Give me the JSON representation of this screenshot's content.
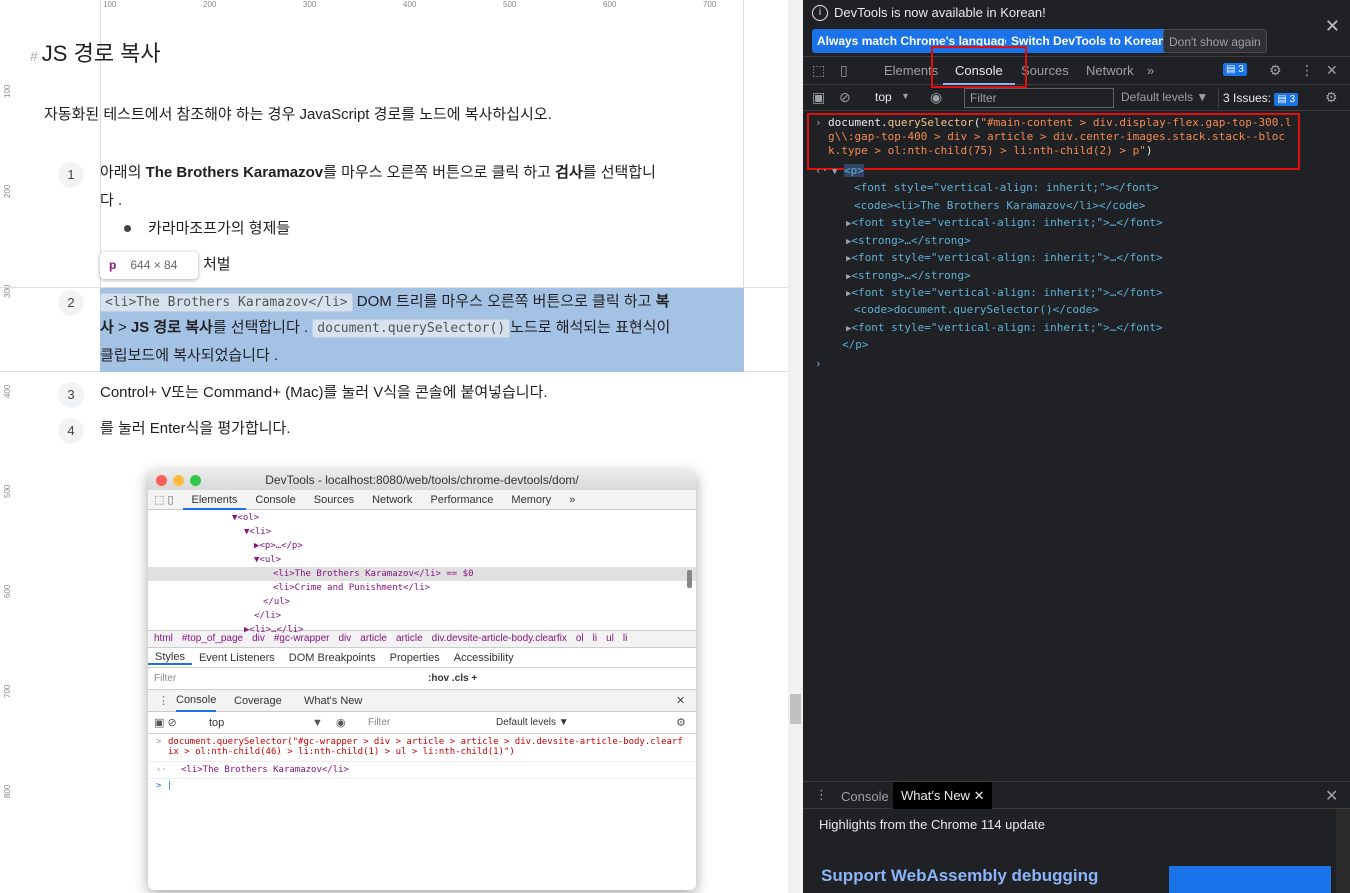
{
  "ruler": {
    "top_ticks": [
      "100",
      "200",
      "300",
      "400",
      "500",
      "600",
      "700"
    ],
    "left_ticks": [
      "100",
      "200",
      "300",
      "400",
      "500",
      "600",
      "700",
      "800"
    ]
  },
  "article": {
    "hash": "#",
    "title": "JS 경로 복사",
    "intro": "자동화된 테스트에서 참조해야 하는 경우 JavaScript 경로를 노드에 복사하십시오.",
    "steps": [
      {
        "num": "1",
        "pre": "아래의 ",
        "bold1": "The Brothers Karamazov",
        "mid": "를 마우스 오른쪽 버튼으로 클릭 하고 ",
        "bold2": "검사",
        "post": "를 선택합니",
        "line2": "다 ."
      },
      {
        "num": "2",
        "code1": "<li>The Brothers Karamazov</li>",
        "t1": " DOM 트리를 마우스 오른쪽 버튼으로 클릭 하고 ",
        "t1b": "복",
        "t2a": "사",
        "t2b": " > ",
        "t2c": "JS 경로 복사",
        "t2d": "를 선택합니다 . ",
        "code2": "document.querySelector()",
        "t2e": "노드로 해석되는 표현식이",
        "t3": "클립보드에 복사되었습니다 ."
      },
      {
        "num": "3",
        "text": "Control+ V또는 Command+ (Mac)를 눌러 V식을 콘솔에 붙여넣습니다."
      },
      {
        "num": "4",
        "text": "를 눌러 Enter식을 평가합니다."
      }
    ],
    "bullets": [
      "카라마조프가의 형제들",
      "처벌"
    ]
  },
  "tooltip": {
    "tag": "p",
    "dims": "644 × 84"
  },
  "screenshot": {
    "title": "DevTools - localhost:8080/web/tools/chrome-devtools/dom/",
    "tabs": [
      "Elements",
      "Console",
      "Sources",
      "Network",
      "Performance",
      "Memory",
      "»"
    ],
    "tree": [
      "▼<ol>",
      "▼<li>",
      "▶<p>…</p>",
      "▼<ul>",
      "<li>The Brothers Karamazov</li> == $0",
      "<li>Crime and Punishment</li>",
      "</ul>",
      "</li>",
      "▶<li>…</li>"
    ],
    "crumbs": [
      "html",
      "#top_of_page",
      "div",
      "#gc-wrapper",
      "div",
      "article",
      "article",
      "div.devsite-article-body.clearfix",
      "ol",
      "li",
      "ul",
      "li"
    ],
    "subtabs": [
      "Styles",
      "Event Listeners",
      "DOM Breakpoints",
      "Properties",
      "Accessibility"
    ],
    "filter_placeholder": "Filter",
    "hov_cls": ":hov  .cls  +",
    "drawer_tabs": [
      "Console",
      "Coverage",
      "What's New"
    ],
    "context": "top",
    "filter2": "Filter",
    "levels": "Default levels ▼",
    "cmd": "document.querySelector(\"#gc-wrapper > div > article > article > div.devsite-article-body.clearfix > ol:nth-child(46) > li:nth-child(1) > ul > li:nth-child(1)\")",
    "result": "<li>The Brothers Karamazov</li>"
  },
  "devtools": {
    "info_msg": "DevTools is now available in Korean!",
    "btn_match": "Always match Chrome's language",
    "btn_switch": "Switch DevTools to Korean",
    "btn_dont": "Don't show again",
    "tabs": [
      "Elements",
      "Console",
      "Sources",
      "Network"
    ],
    "issues_count": "3",
    "context": "top",
    "filter_placeholder": "Filter",
    "levels": "Default levels ▼",
    "issues_label": "3 Issues:",
    "issues_num": "3",
    "cmd_fn": "document.",
    "cmd_method": "querySelector",
    "cmd_arg": "\"#main-content > div.display-flex.gap-top-300.lg\\\\:gap-top-400 > div > article > div.center-images.stack.stack--block.type > ol:nth-child(75) > li:nth-child(2) > p\"",
    "dom": [
      {
        "indent": 0,
        "text": "<p>"
      },
      {
        "indent": 1,
        "text": "<font style=\"vertical-align: inherit;\"></font>"
      },
      {
        "indent": 1,
        "text": "<code><li>The Brothers Karamazov</li></code>"
      },
      {
        "indent": 1,
        "text": "<font style=\"vertical-align: inherit;\">…</font>"
      },
      {
        "indent": 1,
        "text": "<strong>…</strong>"
      },
      {
        "indent": 1,
        "text": "<font style=\"vertical-align: inherit;\">…</font>"
      },
      {
        "indent": 1,
        "text": "<strong>…</strong>"
      },
      {
        "indent": 1,
        "text": "<font style=\"vertical-align: inherit;\">…</font>"
      },
      {
        "indent": 1,
        "text": "<code>document.querySelector()</code>"
      },
      {
        "indent": 1,
        "text": "<font style=\"vertical-align: inherit;\">…</font>"
      },
      {
        "indent": 0,
        "text": "</p>"
      }
    ],
    "drawer_tab1": "Console",
    "drawer_tab2": "What's New",
    "highlights": "Highlights from the Chrome 114 update",
    "wasm": "Support WebAssembly debugging"
  },
  "colors": {
    "accent": "#1a73e8",
    "highlight": "#a4c3e4",
    "red_annotation": "#e01010"
  }
}
